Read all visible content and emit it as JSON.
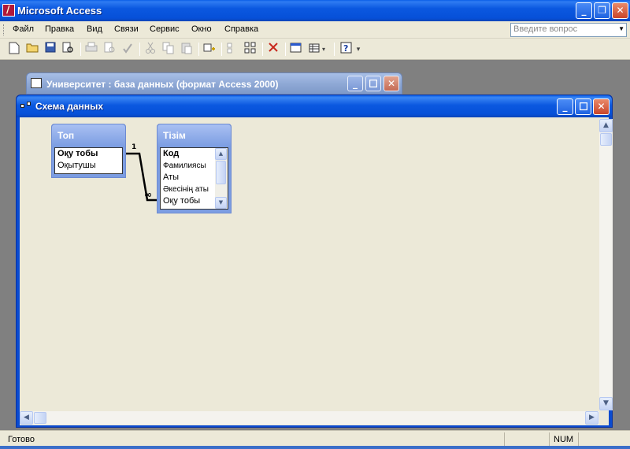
{
  "app": {
    "title": "Microsoft Access"
  },
  "window_buttons": {
    "minimize": "_",
    "restore": "❐",
    "close": "✕"
  },
  "menu": [
    "Файл",
    "Правка",
    "Вид",
    "Связи",
    "Сервис",
    "Окно",
    "Справка"
  ],
  "help": {
    "placeholder": "Введите вопрос"
  },
  "toolbar": {
    "help_dropdown": "▾"
  },
  "db_window": {
    "title": "Университет : база данных (формат Access 2000)"
  },
  "schema_window": {
    "title": "Схема данных"
  },
  "tables": {
    "top": {
      "name": "Топ",
      "fields": [
        "Оқу тобы",
        "Оқытушы"
      ]
    },
    "tizim": {
      "name": "Тізім",
      "fields": [
        "Код",
        "Фамилиясы",
        "Аты",
        "Әкесінің аты",
        "Оқу тобы"
      ]
    }
  },
  "relationship": {
    "one_label": "1",
    "many_label": "∞"
  },
  "status": {
    "text": "Готово",
    "num": "NUM"
  }
}
